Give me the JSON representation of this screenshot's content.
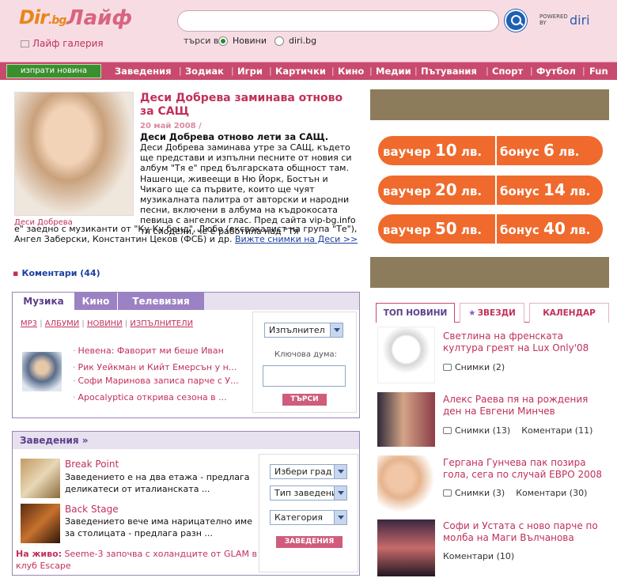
{
  "header": {
    "logo_dir": "Dir",
    "logo_bg": ".bg",
    "logo_lajf": "Лайф",
    "gallery": "Лайф галерия",
    "search_in": "търси в",
    "radio_news": "Новини",
    "radio_diri": "diri.bg",
    "powered": "POWERED",
    "powered_by": "BY",
    "powered_logo": "diri"
  },
  "nav": {
    "send": "изпрати новина",
    "items": [
      "Заведения",
      "Зодиак",
      "Игри",
      "Картички",
      "Кино",
      "Медии",
      "Пътувания",
      "Спорт",
      "Футбол",
      "Fun"
    ]
  },
  "featured": {
    "title": "Деси Добрева заминава отново за САЩ",
    "date": "20 май 2008 /",
    "subtitle": "Деси Добрева отново лети за САЩ.",
    "body": "Деси Добрева заминава утре за САЩ, където ще представи и изпълни песните от новия си албум \"Тя е\" пред българската общност там. Нашенци, живеещи в Ню Йорк, Бостън и Чикаго ще са първите, които ще чуят музикалната палитра от авторски и народни песни, включени в албума на къдрокосата певица с ангелски глас. Пред сайта vip-bg.info тя сподели, че е работила над \"Тя",
    "body2": "е\" заедно с музиканти от \"Ку-Ку бенд\", Любо (ексвокалист на група \"Те\"), Ангел Заберски, Константин Цеков (ФСБ) и др.",
    "link": "Вижте снимки на Деси >>",
    "caption": "Деси Добрева",
    "comments": "Коментари (44)"
  },
  "music": {
    "tabs": [
      "Музика",
      "Кино",
      "Телевизия"
    ],
    "links": [
      "MP3",
      "АЛБУМИ",
      "НОВИНИ",
      "ИЗПЪЛНИТЕЛИ"
    ],
    "items": [
      "Невена: Фаворит ми беше Иван",
      "Рик Уейкман и Кийт Емерсън у н...",
      "Софи Маринова записа парче с У...",
      "Apocalyptica открива сезона в ..."
    ],
    "select": "Изпълнител",
    "keyword_label": "Ключова дума:",
    "search_btn": "ТЪРСИ"
  },
  "venues": {
    "head": "Заведения »",
    "items": [
      {
        "title": "Break Point",
        "desc": "Заведението е на два етажа - предлага деликатеси от италианската ..."
      },
      {
        "title": "Back Stage",
        "desc": "Заведението вече има нарицателно име за столицата - предлага разн ..."
      }
    ],
    "live_label": "На живо:",
    "live_text": "Seeme-3 започва с холандците от GLAM в клуб Escape",
    "selects": [
      "Избери град",
      "Тип заведение",
      "Категория"
    ],
    "btn": "ЗАВЕДЕНИЯ"
  },
  "vouchers": [
    {
      "v_word": "ваучер",
      "v_num": "10",
      "v_unit": "лв.",
      "b_word": "бонус",
      "b_num": "6",
      "b_unit": "лв."
    },
    {
      "v_word": "ваучер",
      "v_num": "20",
      "v_unit": "лв.",
      "b_word": "бонус",
      "b_num": "14",
      "b_unit": "лв."
    },
    {
      "v_word": "ваучер",
      "v_num": "50",
      "v_unit": "лв.",
      "b_word": "бонус",
      "b_num": "40",
      "b_unit": "лв."
    }
  ],
  "news_tabs": [
    "ТОП НОВИНИ",
    "ЗВЕЗДИ",
    "КАЛЕНДАР"
  ],
  "news": [
    {
      "title": "Светлина на френската култура греят на Lux Only'08",
      "photos": "Снимки (2)",
      "comments": ""
    },
    {
      "title": "Алекс Раева пя на рождения ден на Евгени Минчев",
      "photos": "Снимки (13)",
      "comments": "Коментари (11)"
    },
    {
      "title": "Гергана Гунчева пак позира гола, сега по случай ЕВРО 2008",
      "photos": "Снимки (3)",
      "comments": "Коментари (30)"
    },
    {
      "title": "Софи и Устата с ново парче по молба на Маги Вълчанова",
      "photos": "",
      "comments": "Коментари (10)"
    }
  ],
  "colors": {
    "accent": "#c84a6e",
    "link": "#c0305a",
    "voucher": "#ef6a2c",
    "ad": "#8c7c5c"
  }
}
